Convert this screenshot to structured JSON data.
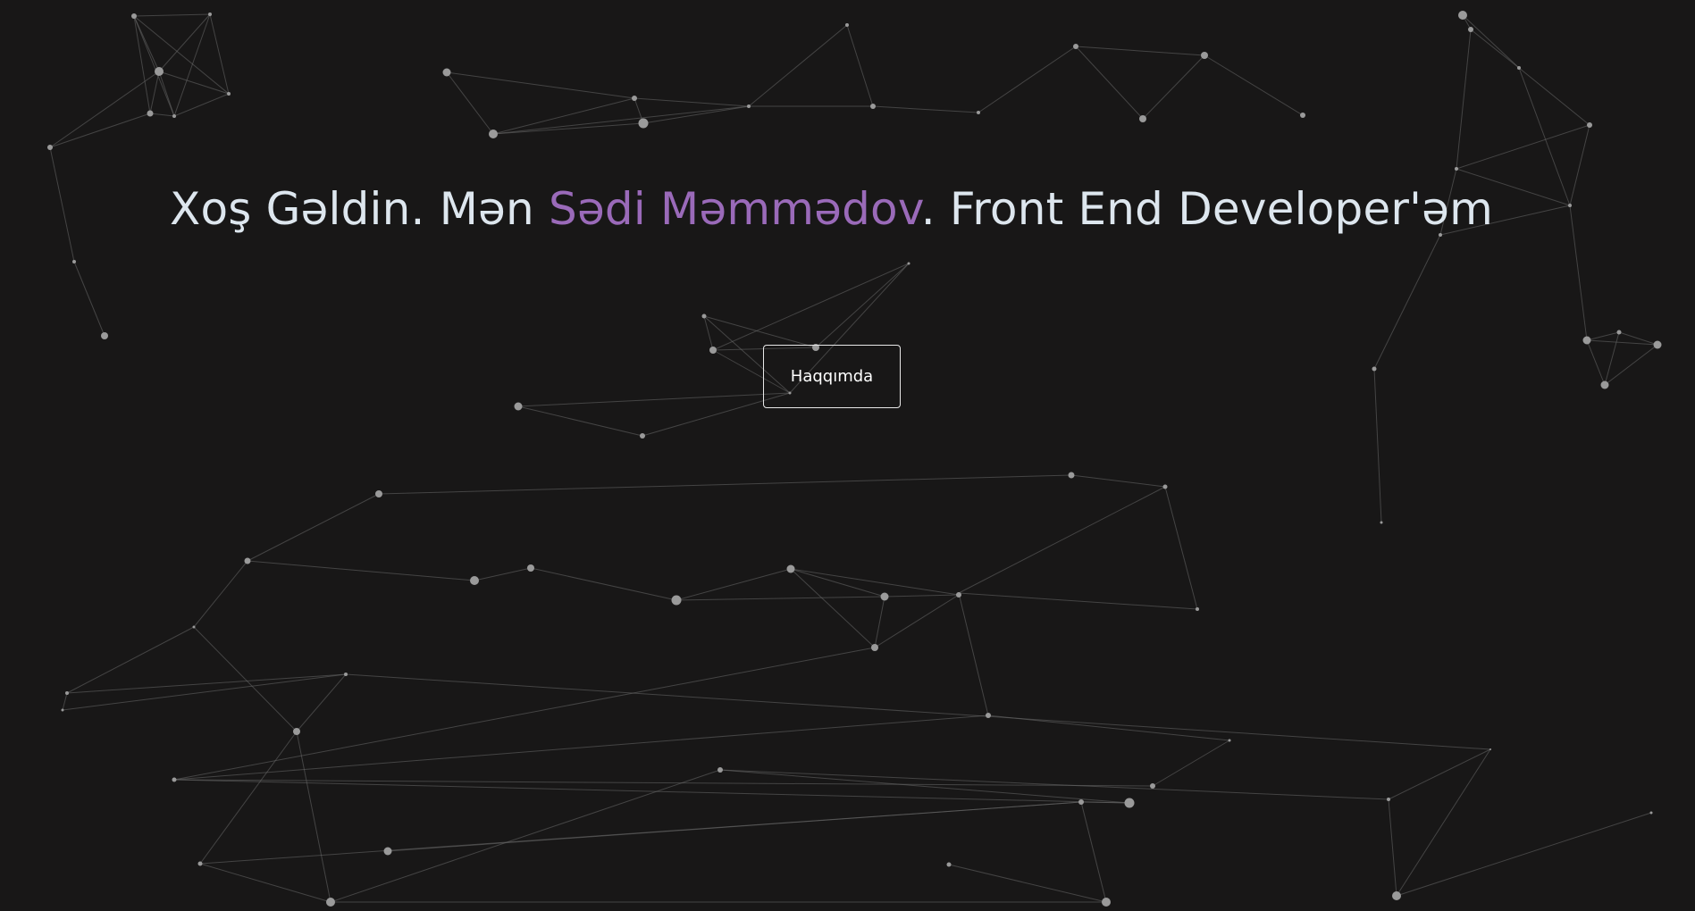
{
  "hero": {
    "headline": {
      "greeting": "Xoş Gəldin. Mən ",
      "name": "Sədi Məmmədov",
      "rest": ". Front End Developer'əm"
    },
    "about_button_label": "Haqqımda"
  },
  "colors": {
    "background": "#181717",
    "text": "#dde6ee",
    "name_accent": "#9a6ab9",
    "particle": "#9a9a9a",
    "particle_line": "#6a6a6a"
  }
}
